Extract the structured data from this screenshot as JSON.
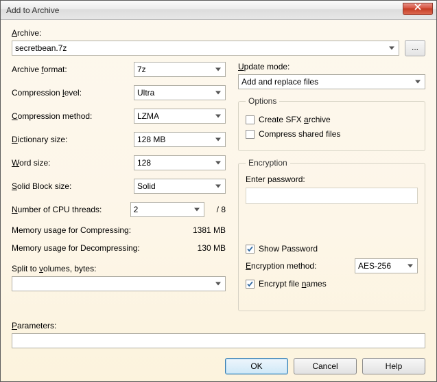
{
  "window": {
    "title": "Add to Archive"
  },
  "archive": {
    "label": "Archive:",
    "value": "secretbean.7z",
    "browse": "..."
  },
  "left": {
    "format_label": "Archive format:",
    "format_value": "7z",
    "level_label": "Compression level:",
    "level_value": "Ultra",
    "method_label": "Compression method:",
    "method_value": "LZMA",
    "dict_label": "Dictionary size:",
    "dict_value": "128 MB",
    "word_label": "Word size:",
    "word_value": "128",
    "block_label": "Solid Block size:",
    "block_value": "Solid",
    "threads_label": "Number of CPU threads:",
    "threads_value": "2",
    "threads_of": "/ 8",
    "mem_comp_label": "Memory usage for Compressing:",
    "mem_comp_value": "1381 MB",
    "mem_decomp_label": "Memory usage for Decompressing:",
    "mem_decomp_value": "130 MB",
    "split_label": "Split to volumes, bytes:",
    "split_value": ""
  },
  "right": {
    "update_label": "Update mode:",
    "update_value": "Add and replace files",
    "options_legend": "Options",
    "sfx_label": "Create SFX archive",
    "sfx_checked": false,
    "shared_label": "Compress shared files",
    "shared_checked": false,
    "enc_legend": "Encryption",
    "pw_label": "Enter password:",
    "pw_value": "",
    "showpw_label": "Show Password",
    "showpw_checked": true,
    "encmethod_label": "Encryption method:",
    "encmethod_value": "AES-256",
    "encnames_label": "Encrypt file names",
    "encnames_checked": true
  },
  "params": {
    "label": "Parameters:",
    "value": ""
  },
  "buttons": {
    "ok": "OK",
    "cancel": "Cancel",
    "help": "Help"
  }
}
